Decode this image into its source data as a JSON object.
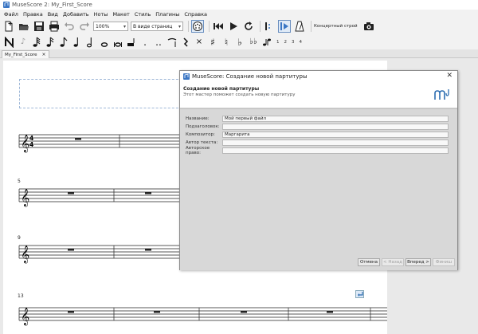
{
  "window": {
    "title": "MuseScore 2: My_First_Score"
  },
  "menu": [
    "Файл",
    "Правка",
    "Вид",
    "Добавить",
    "Ноты",
    "Макет",
    "Стиль",
    "Плагины",
    "Справка"
  ],
  "toolbar": {
    "zoom_value": "100%",
    "view_mode": "В виде страниц",
    "concert_pitch_label": "Концертный строй",
    "icons": [
      "new-file-icon",
      "open-folder-icon",
      "save-icon",
      "print-icon",
      "undo-icon",
      "redo-icon",
      "midi-input-icon",
      "rewind-icon",
      "play-icon",
      "loop-icon",
      "pan-score-icon",
      "metronome-icon",
      "camera-icon"
    ]
  },
  "note_input": {
    "voices": [
      "1",
      "2",
      "3",
      "4"
    ]
  },
  "tabs": [
    {
      "label": "My_First_Score",
      "close": "×"
    }
  ],
  "score": {
    "measure_numbers": [
      "5",
      "9",
      "13"
    ]
  },
  "dialog": {
    "title": "MuseScore: Создание новой партитуры",
    "close": "✕",
    "heading": "Создание новой партитуры",
    "subheading": "Этот мастер поможет создать новую партитуру",
    "fields": [
      {
        "label": "Название:",
        "value": "Мой первый файл"
      },
      {
        "label": "Подзаголовок:",
        "value": ""
      },
      {
        "label": "Композитор:",
        "value": "Маргарита"
      },
      {
        "label": "Автор текста:",
        "value": ""
      },
      {
        "label": "Авторское право:",
        "value": ""
      }
    ],
    "buttons": {
      "cancel": "Отмена",
      "back": "< Назад",
      "next": "Вперед >",
      "finish": "Финиш"
    }
  },
  "colors": {
    "accent": "#2b6cb0",
    "dialog_bg": "#d8d8d8",
    "canvas_bg": "#e9e9e9"
  }
}
